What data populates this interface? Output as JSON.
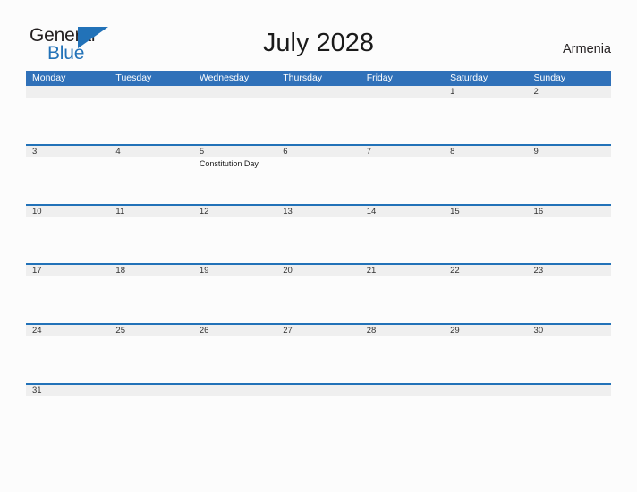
{
  "header": {
    "logo": {
      "word_one": "General",
      "word_two": "Blue",
      "flag_icon": "blue-triangle-flag-icon",
      "color_dark": "#231f20",
      "color_blue": "#2272b8"
    },
    "title": "July 2028",
    "country": "Armenia"
  },
  "calendar": {
    "accent_color": "#3071b9",
    "separator_color": "#2272b8",
    "date_band_color": "#efefef",
    "weekdays": [
      "Monday",
      "Tuesday",
      "Wednesday",
      "Thursday",
      "Friday",
      "Saturday",
      "Sunday"
    ],
    "weeks": [
      {
        "dates": [
          "",
          "",
          "",
          "",
          "",
          "1",
          "2"
        ],
        "events": [
          "",
          "",
          "",
          "",
          "",
          "",
          ""
        ]
      },
      {
        "dates": [
          "3",
          "4",
          "5",
          "6",
          "7",
          "8",
          "9"
        ],
        "events": [
          "",
          "",
          "Constitution Day",
          "",
          "",
          "",
          ""
        ]
      },
      {
        "dates": [
          "10",
          "11",
          "12",
          "13",
          "14",
          "15",
          "16"
        ],
        "events": [
          "",
          "",
          "",
          "",
          "",
          "",
          ""
        ]
      },
      {
        "dates": [
          "17",
          "18",
          "19",
          "20",
          "21",
          "22",
          "23"
        ],
        "events": [
          "",
          "",
          "",
          "",
          "",
          "",
          ""
        ]
      },
      {
        "dates": [
          "24",
          "25",
          "26",
          "27",
          "28",
          "29",
          "30"
        ],
        "events": [
          "",
          "",
          "",
          "",
          "",
          "",
          ""
        ]
      },
      {
        "dates": [
          "31",
          "",
          "",
          "",
          "",
          "",
          ""
        ],
        "events": [
          "",
          "",
          "",
          "",
          "",
          "",
          ""
        ]
      }
    ]
  }
}
